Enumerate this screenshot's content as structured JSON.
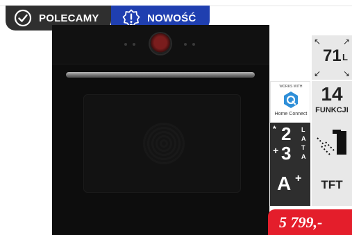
{
  "badges": {
    "recommended": "POLECAMY",
    "new": "NOWOŚĆ",
    "recommended_icon": "check-circle-icon",
    "new_icon": "exclamation-badge-icon",
    "colors": {
      "recommended_bg": "#2f2f2f",
      "new_bg": "#1f3fb0"
    }
  },
  "features": {
    "capacity": {
      "value": "71",
      "unit": "L",
      "icon": "expand-arrows-icon"
    },
    "connectivity": {
      "header": "WORKS WITH",
      "label": "Home Connect",
      "icon": "home-connect-icon"
    },
    "functions": {
      "count": "14",
      "label": "FUNKCJI"
    },
    "warranty": {
      "star": "*",
      "base": "2",
      "plus": "+",
      "extra": "3",
      "letters": [
        "L",
        "A",
        "T",
        "A"
      ]
    },
    "cleaning": {
      "icon": "pyrolytic-cleaning-icon"
    },
    "energy": {
      "class": "A",
      "plus": "+"
    },
    "display": {
      "label": "TFT"
    }
  },
  "price": {
    "text": "5 799,-",
    "color": "#e41e2b"
  },
  "product": {
    "image": "built-in-oven-black"
  }
}
